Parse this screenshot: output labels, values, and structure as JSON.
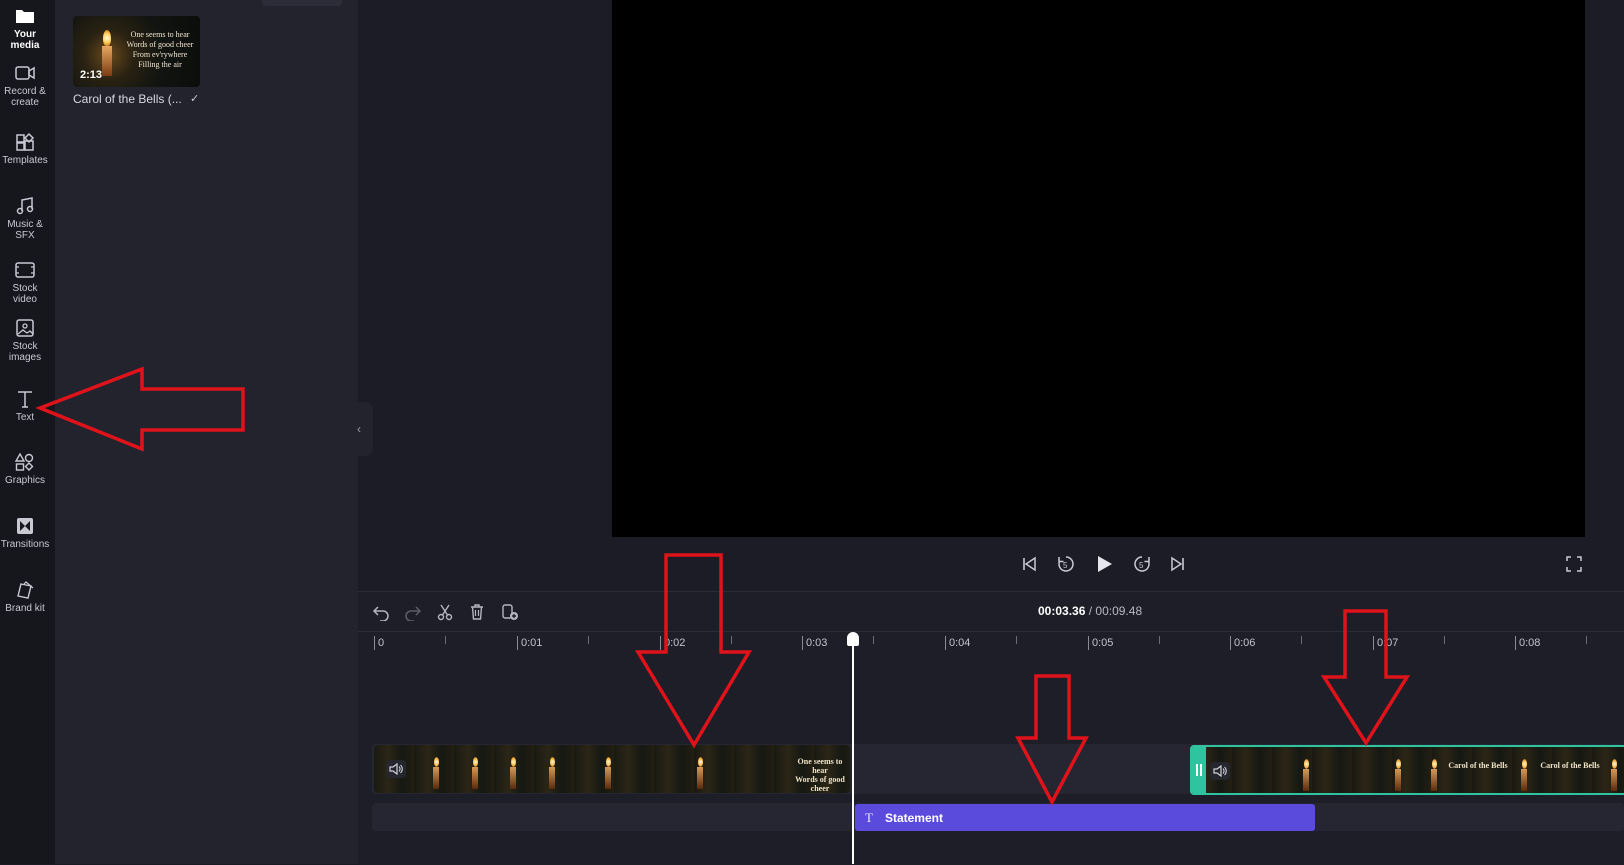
{
  "nav": {
    "items": [
      {
        "label": "Your media",
        "icon": "folder-icon",
        "active": true
      },
      {
        "label": "Record & create",
        "icon": "camera-icon"
      },
      {
        "label": "Templates",
        "icon": "templates-icon"
      },
      {
        "label": "Music & SFX",
        "icon": "music-note-icon"
      },
      {
        "label": "Stock video",
        "icon": "film-icon"
      },
      {
        "label": "Stock images",
        "icon": "image-icon"
      },
      {
        "label": "Text",
        "icon": "text-icon"
      },
      {
        "label": "Graphics",
        "icon": "shapes-icon"
      },
      {
        "label": "Transitions",
        "icon": "transition-icon"
      },
      {
        "label": "Brand kit",
        "icon": "brand-kit-icon"
      }
    ]
  },
  "media": {
    "item_name": "Carol of the Bells (...",
    "duration": "2:13",
    "thumb_lyrics": [
      "One seems to hear",
      "Words of good cheer",
      "From ev'rywhere",
      "Filling the air"
    ]
  },
  "timecode": {
    "current": "00:03.36",
    "separator": "/",
    "total": "00:09.48"
  },
  "ruler": {
    "labels": [
      "0",
      "0:01",
      "0:02",
      "0:03",
      "0:04",
      "0:05",
      "0:06",
      "0:07",
      "0:08"
    ]
  },
  "text_clip": {
    "label": "Statement",
    "icon": "T"
  },
  "clip2_titles": [
    "Carol of the Bells",
    "Carol of the Bells"
  ],
  "colors": {
    "accent": "#5b4bdd",
    "selected_clip_border": "#2ec4a0",
    "annotation": "#e0121a"
  }
}
